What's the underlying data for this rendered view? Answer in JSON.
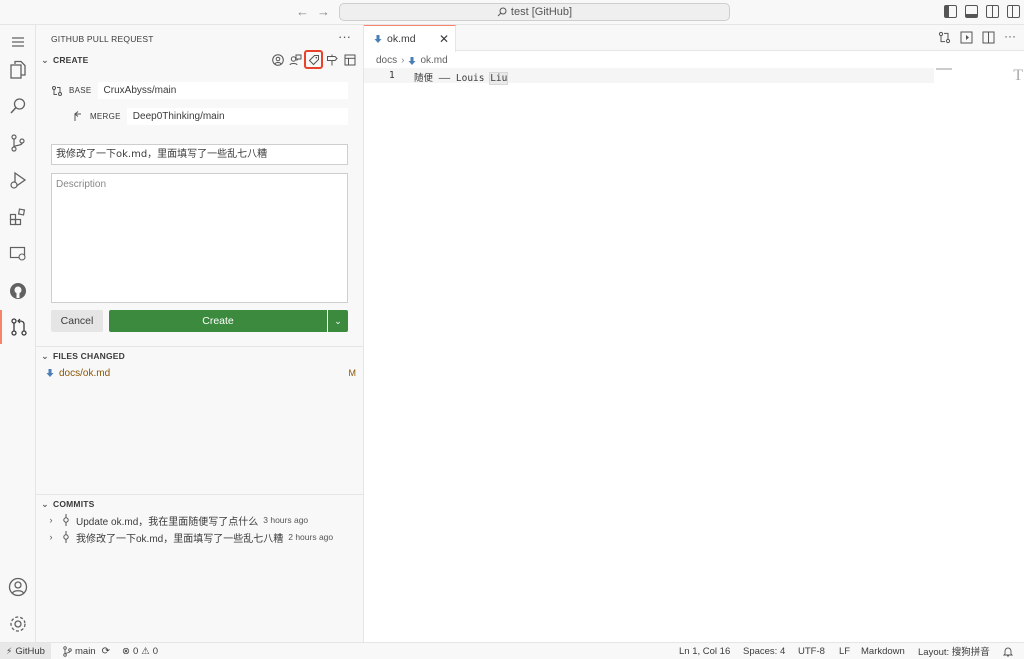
{
  "titlebar": {
    "search_text": "test [GitHub]"
  },
  "activity": {
    "items": [
      "menu",
      "explorer",
      "search",
      "source-control",
      "run-debug",
      "extensions",
      "remote-explorer",
      "github",
      "pull-requests",
      "accounts",
      "manage"
    ]
  },
  "sidebar": {
    "title": "GITHUB PULL REQUEST",
    "more": "···",
    "create_section": "CREATE",
    "base_label": "BASE",
    "base_value": "CruxAbyss/main",
    "merge_label": "MERGE",
    "merge_value": "Deep0Thinking/main",
    "title_value": "我修改了一下ok.md，里面填写了一些乱七八糟",
    "description_placeholder": "Description",
    "cancel_label": "Cancel",
    "create_label": "Create",
    "files_section": "FILES CHANGED",
    "files": [
      {
        "name": "docs/ok.md",
        "status": "M"
      }
    ],
    "commits_section": "COMMITS",
    "commits": [
      {
        "message": "Update ok.md，我在里面随便写了点什么",
        "time": "3 hours ago"
      },
      {
        "message": "我修改了一下ok.md，里面填写了一些乱七八糟",
        "time": "2 hours ago"
      }
    ]
  },
  "editor": {
    "tab_label": "ok.md",
    "breadcrumb_folder": "docs",
    "breadcrumb_file": "ok.md",
    "line_number": "1",
    "code_text": "随便 —— Louis ",
    "code_selected": "Liu"
  },
  "statusbar": {
    "remote": "GitHub",
    "branch": "main",
    "errors": "0",
    "warnings": "0",
    "position": "Ln 1, Col 16",
    "spaces": "Spaces: 4",
    "encoding": "UTF-8",
    "eol": "LF",
    "language": "Markdown",
    "layout": "Layout: 搜狗拼音"
  },
  "colors": {
    "accent": "#f9826c",
    "create_button": "#3b8a3e",
    "highlight_box": "#e8412c",
    "modified": "#895503"
  }
}
